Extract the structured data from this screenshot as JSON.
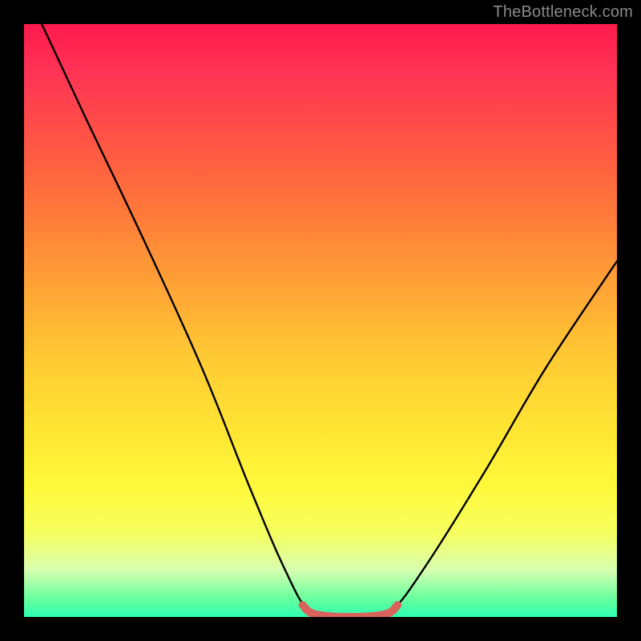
{
  "watermark": "TheBottleneck.com",
  "colors": {
    "frame": "#000000",
    "gradient_top": "#ff1a4d",
    "gradient_bottom": "#2cffb0",
    "curve": "#000000",
    "highlight": "#d9635b"
  },
  "chart_data": {
    "type": "line",
    "title": "",
    "xlabel": "",
    "ylabel": "",
    "xlim": [
      0,
      100
    ],
    "ylim": [
      0,
      100
    ],
    "grid": false,
    "legend": false,
    "annotations": [],
    "series": [
      {
        "name": "curve",
        "note": "V-shaped black curve. Left descends from top-left corner to a flat valley, right ascends to mid-right.",
        "points": [
          {
            "x": 3,
            "y": 100
          },
          {
            "x": 10,
            "y": 85
          },
          {
            "x": 20,
            "y": 64
          },
          {
            "x": 30,
            "y": 42
          },
          {
            "x": 38,
            "y": 22
          },
          {
            "x": 44,
            "y": 8
          },
          {
            "x": 48,
            "y": 1
          },
          {
            "x": 52,
            "y": 0
          },
          {
            "x": 58,
            "y": 0
          },
          {
            "x": 62,
            "y": 1
          },
          {
            "x": 68,
            "y": 9
          },
          {
            "x": 78,
            "y": 25
          },
          {
            "x": 88,
            "y": 42
          },
          {
            "x": 100,
            "y": 60
          }
        ]
      },
      {
        "name": "valley-highlight",
        "note": "Short thick salmon stroke along the flat bottom of the curve.",
        "points": [
          {
            "x": 47,
            "y": 2
          },
          {
            "x": 49,
            "y": 0.5
          },
          {
            "x": 55,
            "y": 0
          },
          {
            "x": 61,
            "y": 0.5
          },
          {
            "x": 63,
            "y": 2
          }
        ]
      }
    ]
  }
}
